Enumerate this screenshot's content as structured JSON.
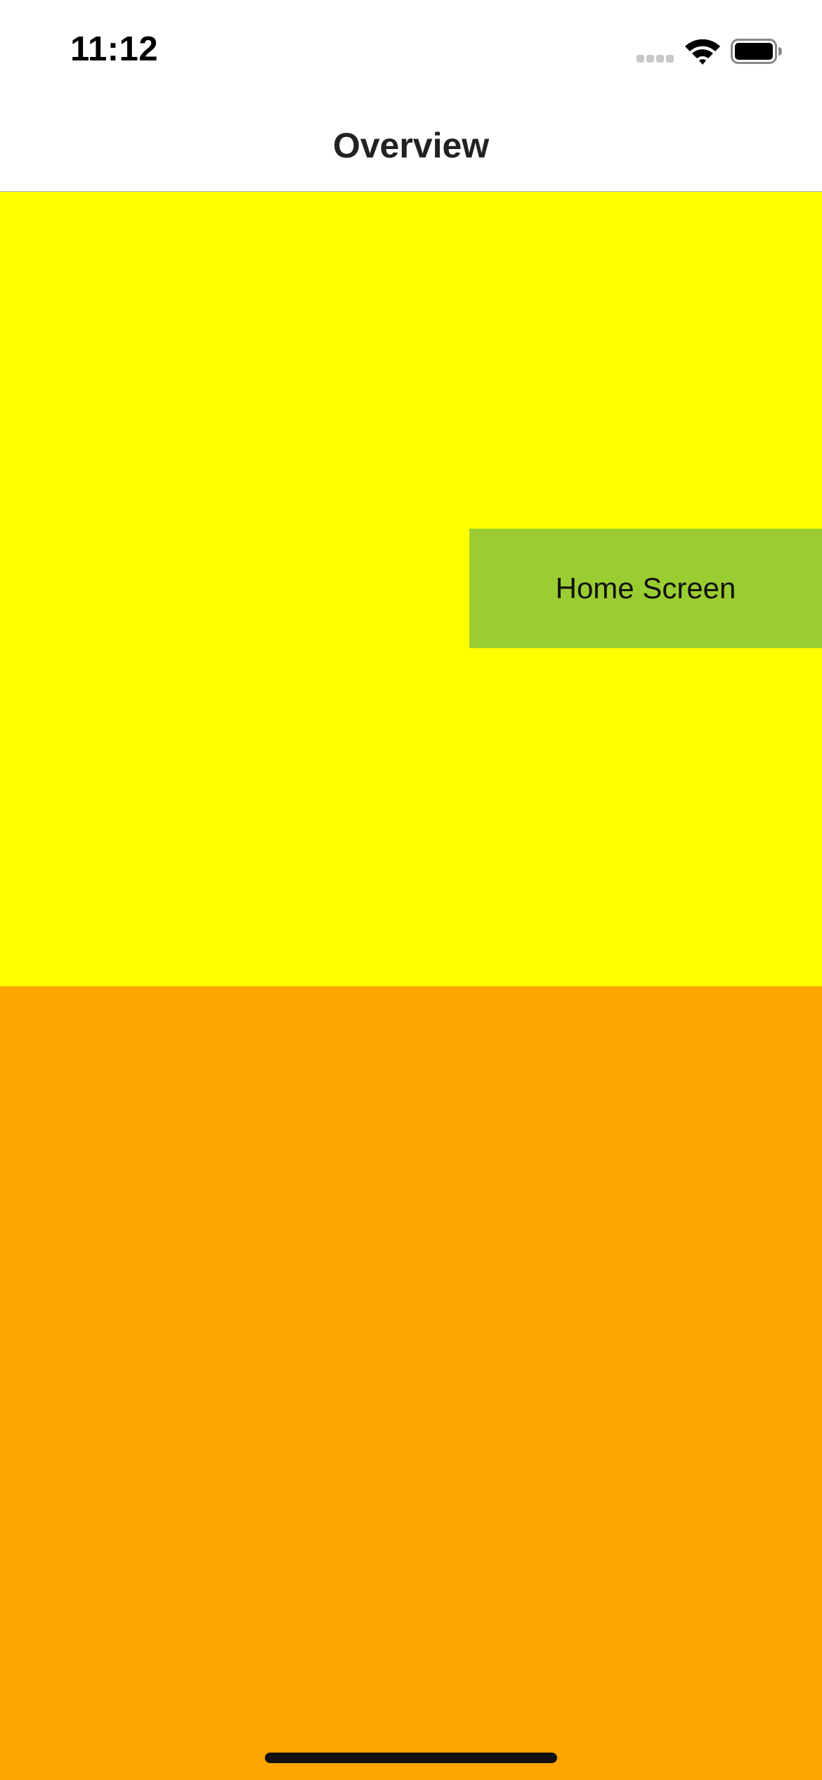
{
  "status_bar": {
    "time": "11:12",
    "icons": [
      "cellular-signal-icon",
      "wifi-icon",
      "battery-icon"
    ]
  },
  "nav_bar": {
    "title": "Overview"
  },
  "content": {
    "top_panel_color": "#ffff00",
    "bottom_panel_color": "#ffa500",
    "home_button": {
      "label": "Home Screen",
      "color": "#9acd32"
    }
  }
}
